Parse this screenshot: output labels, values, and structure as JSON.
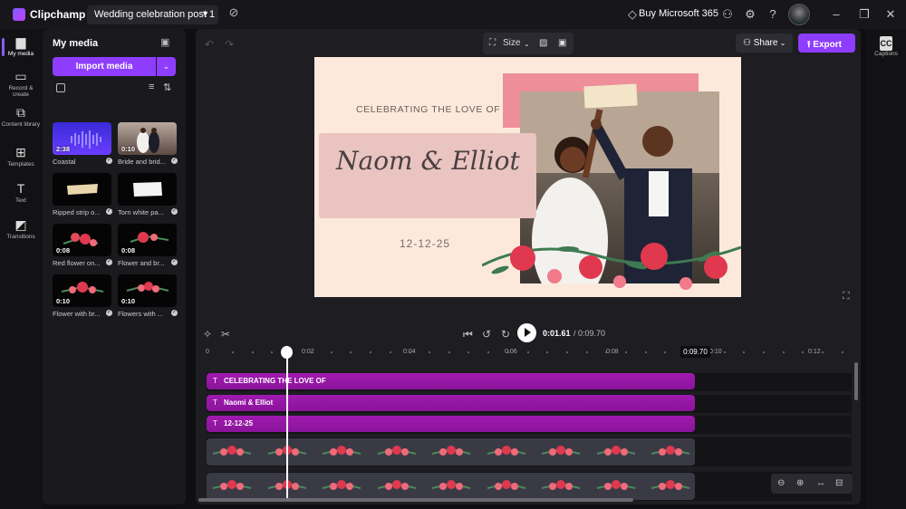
{
  "titlebar": {
    "app_name": "Clipchamp",
    "project_name": "Wedding celebration post 1",
    "buy_label": "Buy Microsoft 365"
  },
  "rail": {
    "items": [
      {
        "label": "My media",
        "icon": "folder-icon"
      },
      {
        "label": "Record & create",
        "icon": "camera-icon"
      },
      {
        "label": "Content library",
        "icon": "library-icon"
      },
      {
        "label": "Templates",
        "icon": "templates-icon"
      },
      {
        "label": "Text",
        "icon": "text-icon"
      },
      {
        "label": "Transitions",
        "icon": "transitions-icon"
      }
    ]
  },
  "right_rail": {
    "captions_label": "Captions",
    "captions_icon_text": "CC"
  },
  "media": {
    "title": "My media",
    "import_label": "Import media",
    "tiles": [
      {
        "label": "Coastal",
        "duration": "2:38"
      },
      {
        "label": "Bride and brid...",
        "duration": "0:10"
      },
      {
        "label": "Ripped strip o...",
        "duration": ""
      },
      {
        "label": "Torn white pa...",
        "duration": ""
      },
      {
        "label": "Red flower on...",
        "duration": "0:08"
      },
      {
        "label": "Flower and br...",
        "duration": "0:08"
      },
      {
        "label": "Flower with br...",
        "duration": "0:10"
      },
      {
        "label": "Flowers with ...",
        "duration": "0:10"
      }
    ]
  },
  "toolbar": {
    "size_label": "Size",
    "share_label": "Share",
    "export_label": "Export"
  },
  "canvas": {
    "celebrate_text": "CELEBRATING THE LOVE OF",
    "names_text": "Naom & Elliot",
    "date_text": "12-12-25"
  },
  "playback": {
    "current_time": "0:01.61",
    "total_time": "/ 0:09.70"
  },
  "timeline": {
    "tick_labels": [
      "0",
      "0:02",
      "0:04",
      "0:06",
      "0:08",
      "0:10",
      "0:12"
    ],
    "end_marker": "0:09.70",
    "text_tracks": [
      "CELEBRATING THE LOVE OF",
      "Naomi & Elliot",
      "12-12-25"
    ]
  },
  "colors": {
    "accent": "#8e3dff",
    "clip_text": "#a01ab0",
    "canvas_bg": "#fde9dc"
  }
}
